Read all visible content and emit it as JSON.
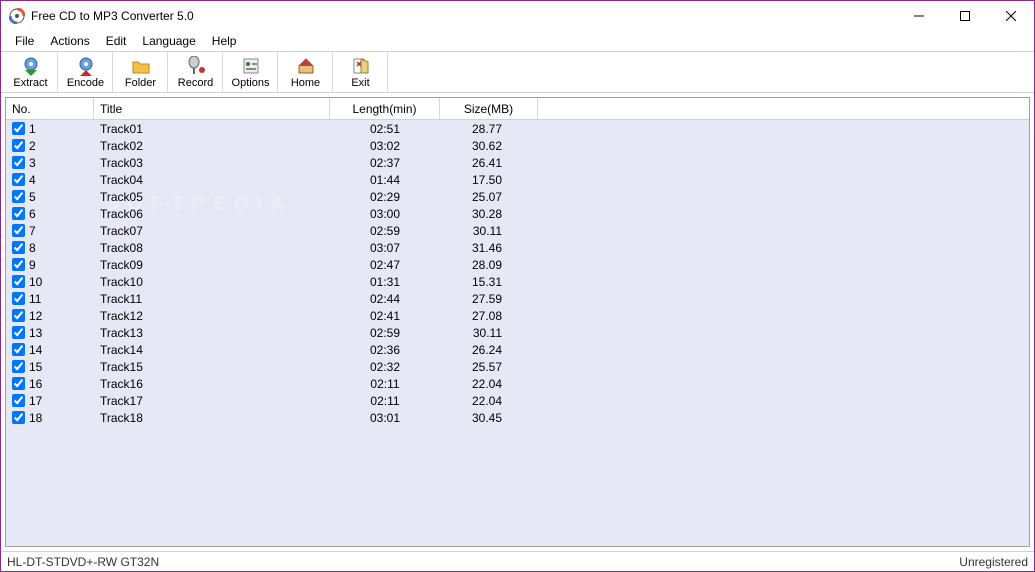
{
  "window": {
    "title": "Free CD to MP3 Converter 5.0"
  },
  "menu": {
    "file": "File",
    "actions": "Actions",
    "edit": "Edit",
    "language": "Language",
    "help": "Help"
  },
  "toolbar": {
    "extract": "Extract",
    "encode": "Encode",
    "folder": "Folder",
    "record": "Record",
    "options": "Options",
    "home": "Home",
    "exit": "Exit"
  },
  "columns": {
    "no": "No.",
    "title": "Title",
    "length": "Length(min)",
    "size": "Size(MB)"
  },
  "tracks": [
    {
      "no": "1",
      "title": "Track01",
      "length": "02:51",
      "size": "28.77"
    },
    {
      "no": "2",
      "title": "Track02",
      "length": "03:02",
      "size": "30.62"
    },
    {
      "no": "3",
      "title": "Track03",
      "length": "02:37",
      "size": "26.41"
    },
    {
      "no": "4",
      "title": "Track04",
      "length": "01:44",
      "size": "17.50"
    },
    {
      "no": "5",
      "title": "Track05",
      "length": "02:29",
      "size": "25.07"
    },
    {
      "no": "6",
      "title": "Track06",
      "length": "03:00",
      "size": "30.28"
    },
    {
      "no": "7",
      "title": "Track07",
      "length": "02:59",
      "size": "30.11"
    },
    {
      "no": "8",
      "title": "Track08",
      "length": "03:07",
      "size": "31.46"
    },
    {
      "no": "9",
      "title": "Track09",
      "length": "02:47",
      "size": "28.09"
    },
    {
      "no": "10",
      "title": "Track10",
      "length": "01:31",
      "size": "15.31"
    },
    {
      "no": "11",
      "title": "Track11",
      "length": "02:44",
      "size": "27.59"
    },
    {
      "no": "12",
      "title": "Track12",
      "length": "02:41",
      "size": "27.08"
    },
    {
      "no": "13",
      "title": "Track13",
      "length": "02:59",
      "size": "30.11"
    },
    {
      "no": "14",
      "title": "Track14",
      "length": "02:36",
      "size": "26.24"
    },
    {
      "no": "15",
      "title": "Track15",
      "length": "02:32",
      "size": "25.57"
    },
    {
      "no": "16",
      "title": "Track16",
      "length": "02:11",
      "size": "22.04"
    },
    {
      "no": "17",
      "title": "Track17",
      "length": "02:11",
      "size": "22.04"
    },
    {
      "no": "18",
      "title": "Track18",
      "length": "03:01",
      "size": "30.45"
    }
  ],
  "status": {
    "left": "HL-DT-STDVD+-RW GT32N",
    "right": "Unregistered"
  },
  "watermark": "SOFTPEDIA"
}
